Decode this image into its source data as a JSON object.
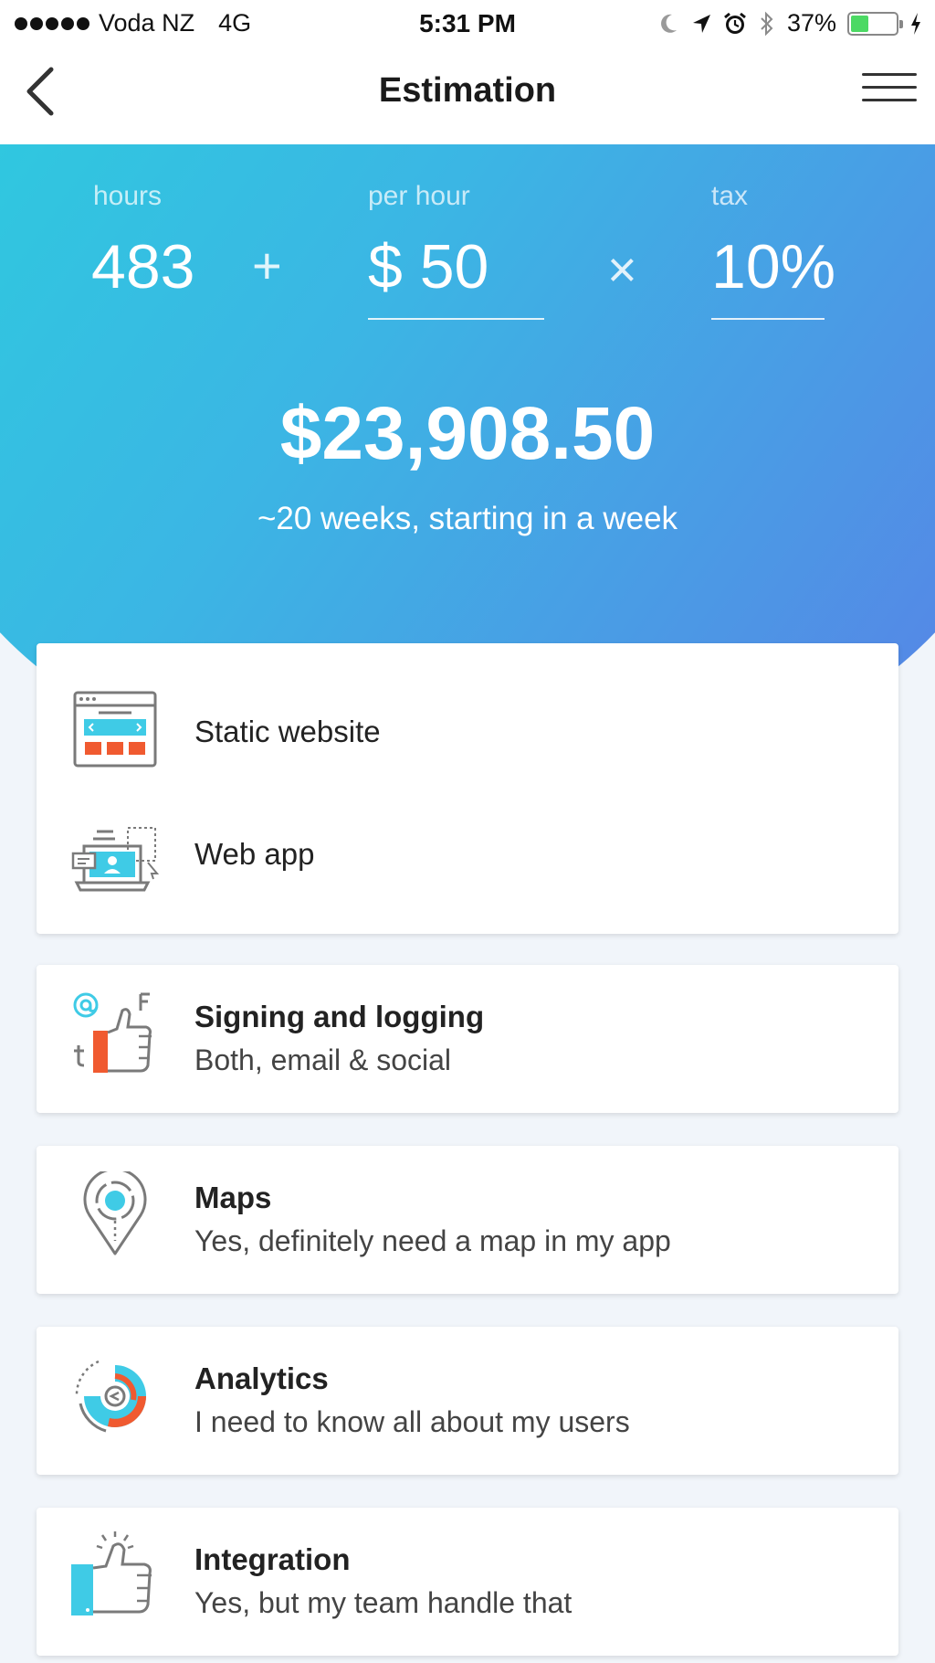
{
  "status_bar": {
    "carrier": "Voda NZ",
    "network": "4G",
    "time": "5:31 PM",
    "battery": "37%",
    "battery_level": 0.37
  },
  "nav": {
    "title": "Estimation",
    "back_icon": "chevron-left-icon",
    "menu_icon": "hamburger-menu-icon"
  },
  "estimate": {
    "hours_label": "hours",
    "hours_value": "483",
    "plus_symbol": "+",
    "rate_label": "per hour",
    "rate_value": "$ 50",
    "times_symbol": "×",
    "tax_label": "tax",
    "tax_value": "10%",
    "total": "$23,908.50",
    "duration": "~20 weeks, starting in a week"
  },
  "options": {
    "static_website": {
      "label": "Static website",
      "icon": "website-layout-icon"
    },
    "web_app": {
      "label": "Web app",
      "icon": "web-app-laptop-icon"
    },
    "signing": {
      "title": "Signing and logging",
      "subtitle": "Both, email & social",
      "icon": "social-login-thumbs-up-icon"
    },
    "maps": {
      "title": "Maps",
      "subtitle": "Yes, definitely need a map in my app",
      "icon": "map-pin-icon"
    },
    "analytics": {
      "title": "Analytics",
      "subtitle": "I need to know all about my users",
      "icon": "analytics-donut-icon"
    },
    "integration": {
      "title": "Integration",
      "subtitle": "Yes, but my team handle that",
      "icon": "integration-thumbs-up-icon"
    }
  },
  "colors": {
    "gradient_start": "#28d3dc",
    "gradient_end": "#5a7fe6",
    "accent_cyan": "#3fcbe6",
    "accent_orange": "#f05a30",
    "icon_gray": "#7a7a7a"
  }
}
